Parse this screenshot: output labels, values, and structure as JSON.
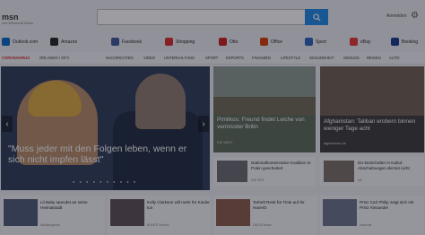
{
  "header": {
    "logo": "msn",
    "logo_sub": "von Microsoft News",
    "signin": "Anmelden"
  },
  "quicklinks": [
    {
      "label": "Outlook.com",
      "color": "#0a64c8"
    },
    {
      "label": "Amazon",
      "color": "#222222"
    },
    {
      "label": "Facebook",
      "color": "#3b5998"
    },
    {
      "label": "Shopping",
      "color": "#d92a2a"
    },
    {
      "label": "Otto",
      "color": "#c81e1e"
    },
    {
      "label": "Office",
      "color": "#d83b01"
    },
    {
      "label": "Sport",
      "color": "#2a62b8"
    },
    {
      "label": "eBay",
      "color": "#e53238"
    },
    {
      "label": "Booking",
      "color": "#123a8a"
    }
  ],
  "nav": {
    "coronavirus": "CORONAVIRUS",
    "weather": "ORLANDO / 29°C",
    "items": [
      "NACHRICHTEN",
      "VIDEO",
      "UNTERHALTUNG",
      "SPORT",
      "ESPORTS",
      "FINANZEN",
      "LIFESTYLE",
      "GESUNDHEIT",
      "GENUSS",
      "REISEN",
      "AUTO"
    ]
  },
  "hero": {
    "title": "\"Muss jeder mit den Folgen leben, wenn er sich nicht impfen lässt\""
  },
  "tiles": [
    {
      "title": "Pimlikos: Freund findet Leiche von vermisster Britin",
      "source": "DIE WELT"
    },
    {
      "title": "Afghanistan: Taliban erobern binnen weniger Tage acht",
      "source": "tagesschau.de"
    }
  ],
  "cards": [
    {
      "text": "Nationalkonservative Koalition in Polen gescheitert",
      "source": "DIE ZEIT"
    },
    {
      "text": "EU-Botschafter in Kabul: Abschiebungen derzeit nicht",
      "source": "ntv"
    }
  ],
  "bottom": [
    {
      "text": "Lil Baby spendet an seine Heimatstadt",
      "source": "Musikexpress"
    },
    {
      "text": "Kelly Clarkson will mehr für Kinder tun",
      "source": "BUNTE Stories"
    },
    {
      "text": "Torhelt Reist für Tinte auf Ihr Haverlz",
      "source": "DELTA News"
    },
    {
      "text": "Prinz Carl Philip zeigt sich mit Prinz Alexander",
      "source": "news.de"
    }
  ]
}
